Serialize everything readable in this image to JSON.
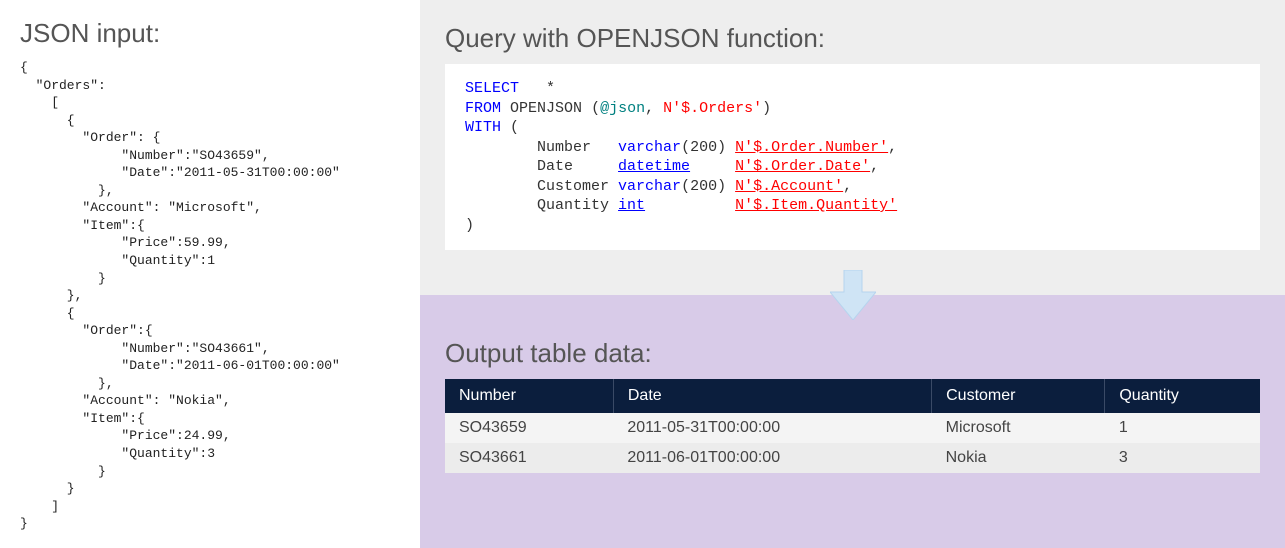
{
  "left": {
    "title": "JSON input:",
    "json_text": "{\n  \"Orders\":\n    [\n      {\n        \"Order\": {\n             \"Number\":\"SO43659\",\n             \"Date\":\"2011-05-31T00:00:00\"\n          },\n        \"Account\": \"Microsoft\",\n        \"Item\":{\n             \"Price\":59.99,\n             \"Quantity\":1\n          }\n      },\n      {\n        \"Order\":{\n             \"Number\":\"SO43661\",\n             \"Date\":\"2011-06-01T00:00:00\"\n          },\n        \"Account\": \"Nokia\",\n        \"Item\":{\n             \"Price\":24.99,\n             \"Quantity\":3\n          }\n      }\n    ]\n}"
  },
  "query": {
    "title": "Query with OPENJSON function:",
    "kw_select": "SELECT",
    "star": "*",
    "kw_from": "FROM",
    "fn": "OPENJSON",
    "paren_open": "(",
    "at_json": "@json",
    "comma": ",",
    "path_orders": "N'$.Orders'",
    "paren_close": ")",
    "kw_with": "WITH",
    "with_open": "(",
    "col1_name": "Number",
    "col1_type": "varchar",
    "col1_len": "(200)",
    "col1_path": "N'$.Order.Number'",
    "col2_name": "Date",
    "col2_type": "datetime",
    "col2_path": "N'$.Order.Date'",
    "col3_name": "Customer",
    "col3_type": "varchar",
    "col3_len": "(200)",
    "col3_path": "N'$.Account'",
    "col4_name": "Quantity",
    "col4_type": "int",
    "col4_path": "N'$.Item.Quantity'",
    "with_close": ")"
  },
  "output": {
    "title": "Output table data:",
    "headers": [
      "Number",
      "Date",
      "Customer",
      "Quantity"
    ],
    "rows": [
      [
        "SO43659",
        "2011-05-31T00:00:00",
        "Microsoft",
        "1"
      ],
      [
        "SO43661",
        "2011-06-01T00:00:00",
        "Nokia",
        "3"
      ]
    ]
  }
}
